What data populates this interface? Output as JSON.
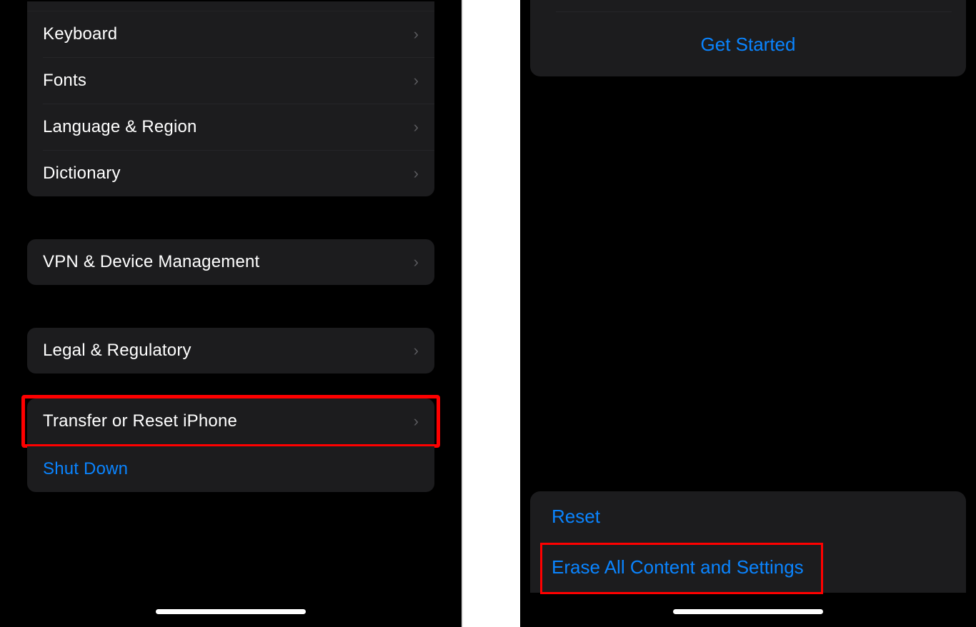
{
  "colors": {
    "accent": "#0a84ff",
    "highlight": "#ff0000",
    "cardBg": "#1c1c1e",
    "fg": "#ffffff"
  },
  "left": {
    "group1": {
      "items": [
        {
          "label": "Keyboard"
        },
        {
          "label": "Fonts"
        },
        {
          "label": "Language & Region"
        },
        {
          "label": "Dictionary"
        }
      ]
    },
    "group2": {
      "items": [
        {
          "label": "VPN & Device Management"
        }
      ]
    },
    "group3": {
      "items": [
        {
          "label": "Legal & Regulatory"
        }
      ]
    },
    "group4": {
      "items": [
        {
          "label": "Transfer or Reset iPhone"
        },
        {
          "label": "Shut Down"
        }
      ]
    }
  },
  "right": {
    "getStarted": "Get Started",
    "bottom": {
      "reset": "Reset",
      "erase": "Erase All Content and Settings"
    }
  }
}
